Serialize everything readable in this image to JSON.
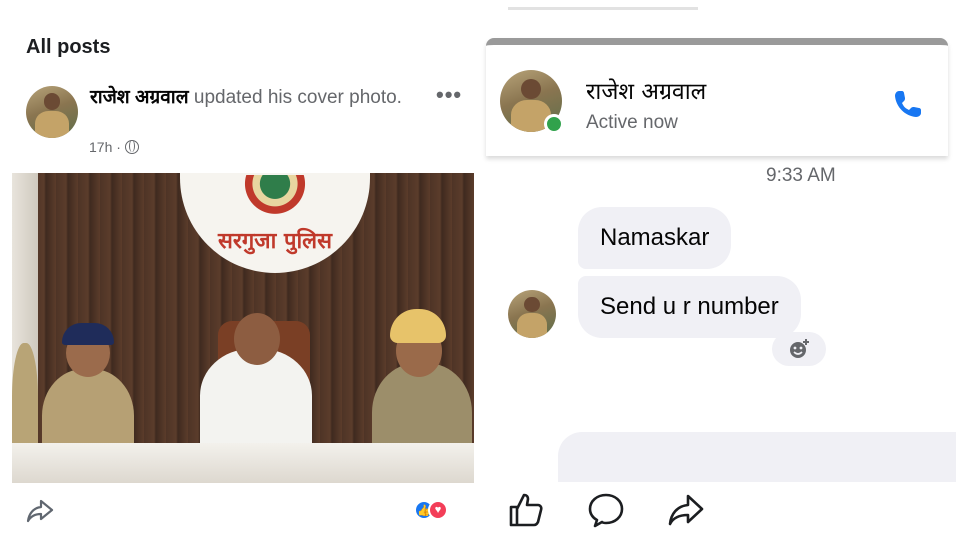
{
  "left_panel": {
    "section_title": "All posts",
    "post": {
      "author": "राजेश अग्रवाल",
      "action": " updated his cover photo.",
      "time": "17h ·",
      "privacy_icon": "globe-icon",
      "more_icon": "more-dots-icon",
      "photo_sign": "सरगुजा पुलिस"
    },
    "footer": {
      "share_icon": "share-icon",
      "reactions": [
        "like",
        "love"
      ],
      "like_glyph": "👍",
      "love_glyph": "♥"
    }
  },
  "right_panel": {
    "contact_name": "राजेश अग्रवाल",
    "contact_status": "Active now",
    "call_icon": "phone-icon",
    "timestamp": "9:33 AM",
    "messages": [
      {
        "text": "Namaskar"
      },
      {
        "text": "Send u r number"
      }
    ],
    "react_icon": "add-reaction-icon",
    "action_bar": [
      "like-icon",
      "comment-icon",
      "share-icon"
    ]
  },
  "colors": {
    "accent_blue": "#1877f2",
    "online_green": "#31a24c",
    "bubble_bg": "#f0f0f5",
    "muted_text": "#65676b"
  }
}
